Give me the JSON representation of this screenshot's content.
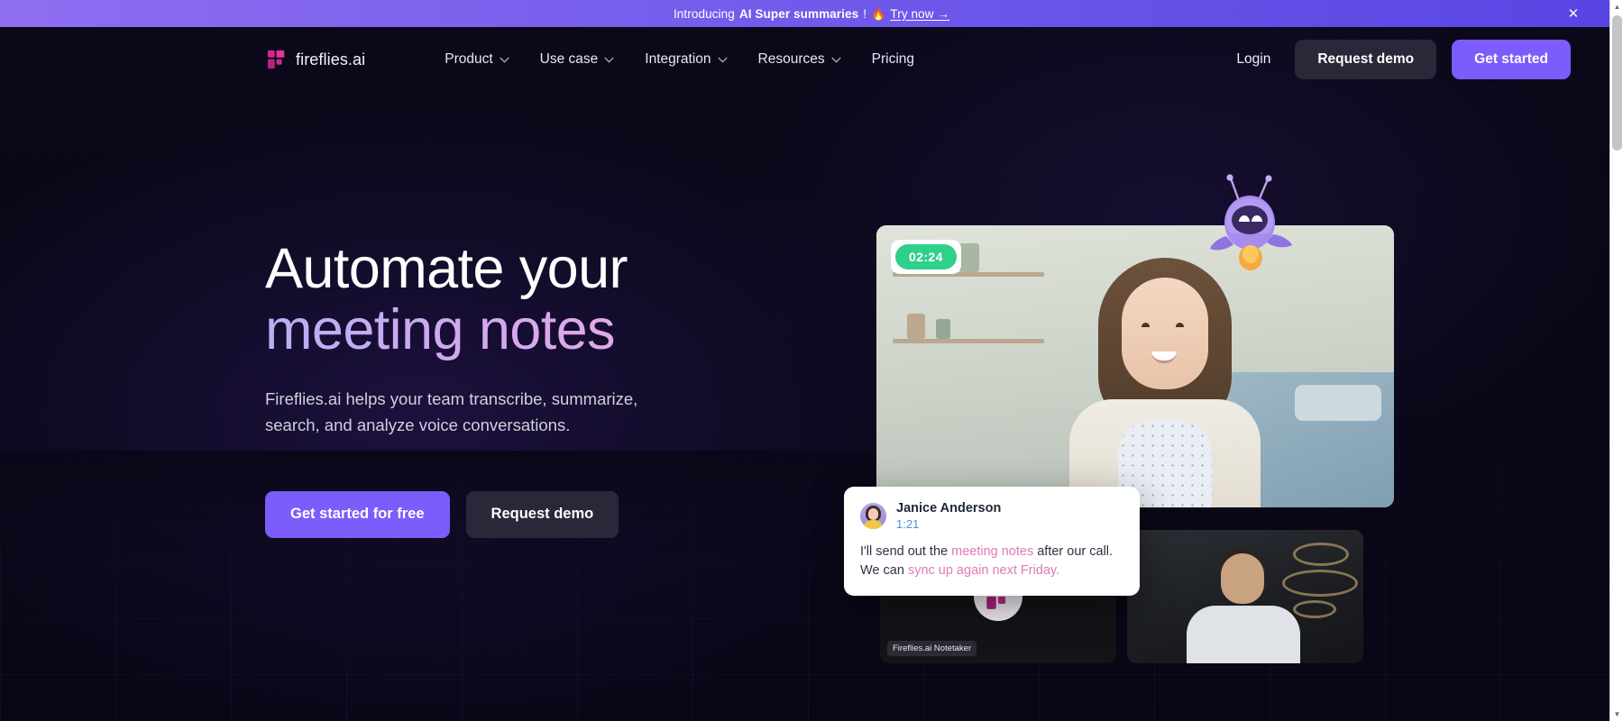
{
  "banner": {
    "intro_text": "Introducing ",
    "strong_text": "AI Super summaries",
    "exclaim": "!",
    "fire_icon": "🔥",
    "link_label": "Try now →",
    "close_icon": "✕",
    "background_color": "#7a62ed"
  },
  "nav": {
    "brand_name": "fireflies.ai",
    "links": [
      {
        "label": "Product",
        "has_chevron": true
      },
      {
        "label": "Use case",
        "has_chevron": true
      },
      {
        "label": "Integration",
        "has_chevron": true
      },
      {
        "label": "Resources",
        "has_chevron": true
      },
      {
        "label": "Pricing",
        "has_chevron": false
      }
    ],
    "login_label": "Login",
    "request_demo_label": "Request demo",
    "get_started_label": "Get started",
    "primary_color": "#7c5cfa"
  },
  "hero": {
    "headline_line1": "Automate your",
    "headline_line2": "meeting notes",
    "subhead": "Fireflies.ai helps your team transcribe, summarize, search, and analyze voice conversations.",
    "cta_primary": "Get started for free",
    "cta_secondary": "Request demo"
  },
  "visual": {
    "timer": "02:24",
    "timer_color": "#2fd08a",
    "chat": {
      "name": "Janice Anderson",
      "time": "1:21",
      "message_part1": "I'll send out the ",
      "message_highlight1": "meeting notes",
      "message_part2": " after our call. We can ",
      "message_highlight2": "sync up again next Friday.",
      "highlight_color": "#e07ab5"
    },
    "notetaker_label": "Fireflies.ai Notetaker"
  },
  "scrollbar": {
    "up_arrow": "▲",
    "down_arrow": "▼"
  }
}
